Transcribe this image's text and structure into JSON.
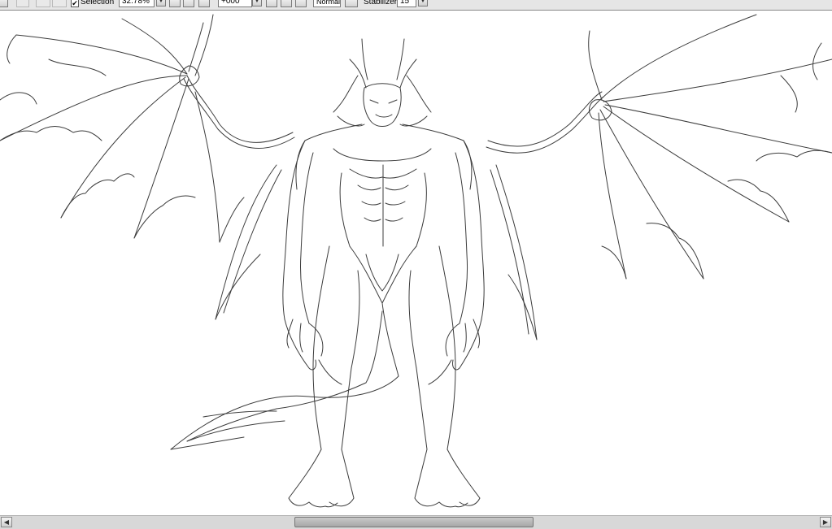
{
  "toolbar": {
    "selection_label": "Selection",
    "selection_checked": "✔",
    "zoom_value": "32.78%",
    "rotation_value": "+000°",
    "blend_mode": "Normal",
    "stabilizer_label": "Stabilizer",
    "stabilizer_value": "15"
  },
  "scrollbar": {
    "horizontal_thumb_fraction": 0.29,
    "horizontal_thumb_position": 0.36
  },
  "canvas": {
    "artwork": "winged-demon-lineart-sketch"
  },
  "icons": {
    "left_arrow": "◀",
    "right_arrow": "▶",
    "dropdown_arrow": "▼"
  }
}
